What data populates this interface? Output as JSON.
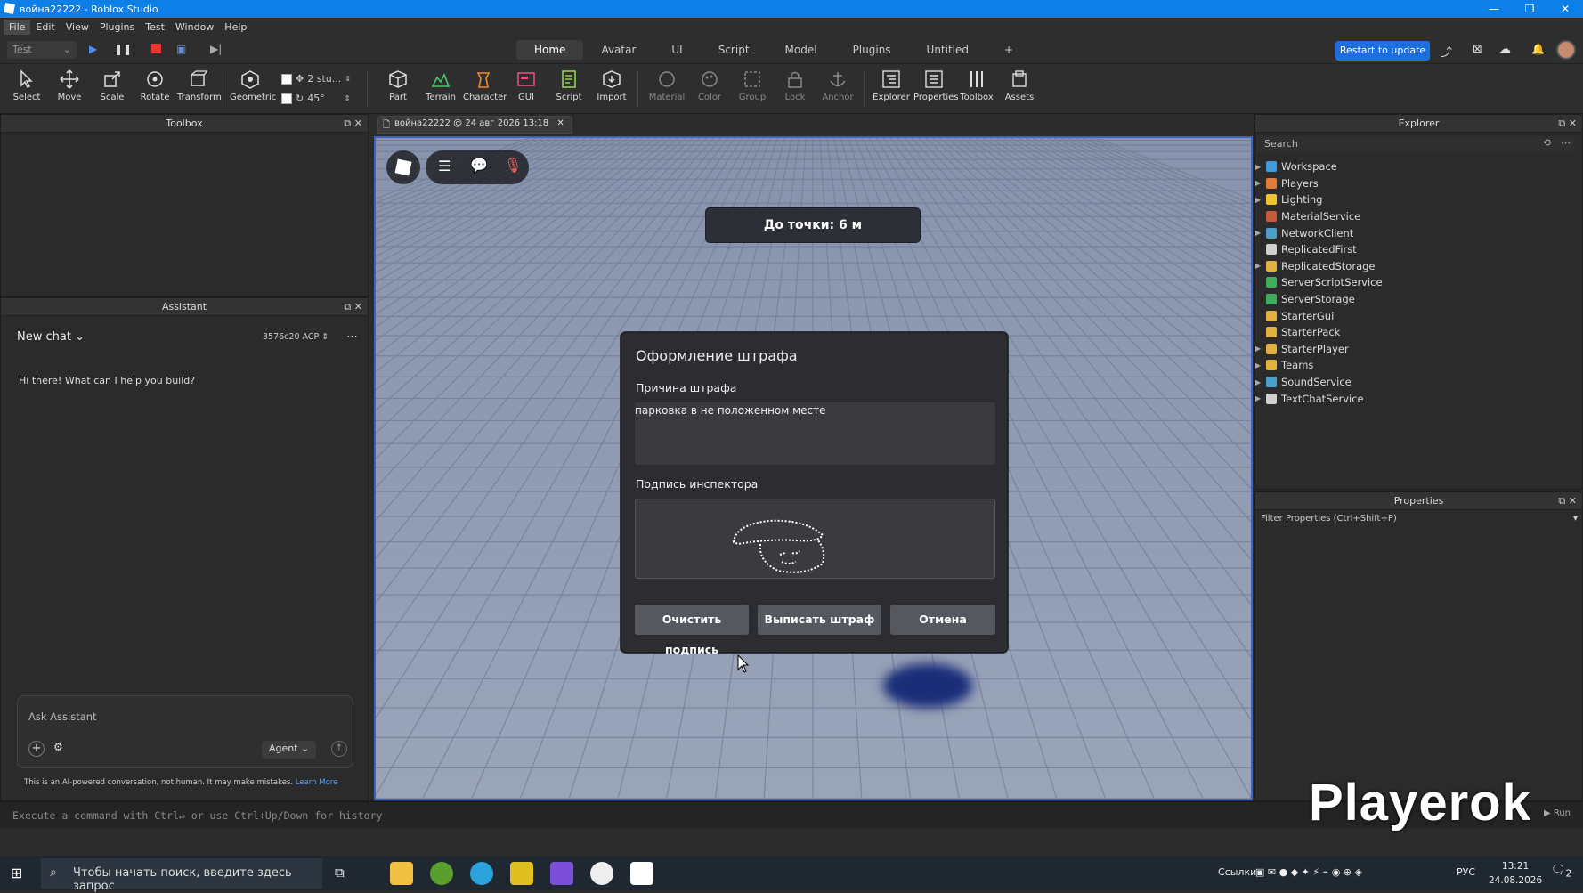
{
  "window": {
    "title": "война22222 - Roblox Studio",
    "min": "—",
    "max": "❐",
    "close": "✕"
  },
  "menu": [
    "File",
    "Edit",
    "View",
    "Plugins",
    "Test",
    "Window",
    "Help"
  ],
  "test_select": "Test",
  "ribbon_tabs": [
    "Home",
    "Avatar",
    "UI",
    "Script",
    "Model",
    "Plugins",
    "Untitled",
    "+"
  ],
  "restart_button": "Restart to update",
  "tools": {
    "select": "Select",
    "move": "Move",
    "scale": "Scale",
    "rotate": "Rotate",
    "transform": "Transform",
    "geometric": "Geometric",
    "stud_value": "2 stu...",
    "angle_value": "45°",
    "part": "Part",
    "terrain": "Terrain",
    "character": "Character",
    "gui": "GUI",
    "script": "Script",
    "import": "Import",
    "material": "Material",
    "color": "Color",
    "group": "Group",
    "lock": "Lock",
    "anchor": "Anchor",
    "explorer": "Explorer",
    "properties": "Properties",
    "toolbox": "Toolbox",
    "assets": "Assets"
  },
  "toolbox": {
    "title": "Toolbox"
  },
  "assistant": {
    "title": "Assistant",
    "chat_name": "New chat",
    "model": "3576c20 ACP",
    "greeting": "Hi there! What can I help you build?",
    "input_placeholder": "Ask Assistant",
    "agent": "Agent",
    "disclaimer": "This is an AI-powered conversation, not human. It may make mistakes.",
    "learn_more": "Learn More"
  },
  "doc_tab": {
    "label": "война22222 @ 24 авг 2026 13:18",
    "close": "✕"
  },
  "game": {
    "distance": "До точки: 6 м",
    "modal": {
      "title": "Оформление штрафа",
      "reason_label": "Причина штрафа",
      "reason_value": "парковка в не положенном месте",
      "signature_label": "Подпись инспектора",
      "clear_btn": "Очистить подпись",
      "issue_btn": "Выписать штраф",
      "cancel_btn": "Отмена"
    }
  },
  "explorer": {
    "title": "Explorer",
    "search_placeholder": "Search",
    "items": [
      {
        "label": "Workspace",
        "expand": true,
        "icon": "workspace-icon",
        "color": "#3e9bdc"
      },
      {
        "label": "Players",
        "expand": true,
        "icon": "players-icon",
        "color": "#e07b39"
      },
      {
        "label": "Lighting",
        "expand": true,
        "icon": "lighting-icon",
        "color": "#f0c330"
      },
      {
        "label": "MaterialService",
        "expand": false,
        "icon": "material-service-icon",
        "color": "#c75a3a"
      },
      {
        "label": "NetworkClient",
        "expand": true,
        "icon": "network-client-icon",
        "color": "#4aa0c8"
      },
      {
        "label": "ReplicatedFirst",
        "expand": false,
        "icon": "replicated-first-icon",
        "color": "#cfcfcf"
      },
      {
        "label": "ReplicatedStorage",
        "expand": true,
        "icon": "replicated-storage-icon",
        "color": "#e0b040"
      },
      {
        "label": "ServerScriptService",
        "expand": false,
        "icon": "server-script-service-icon",
        "color": "#3fae5a"
      },
      {
        "label": "ServerStorage",
        "expand": false,
        "icon": "server-storage-icon",
        "color": "#3fae5a"
      },
      {
        "label": "StarterGui",
        "expand": false,
        "icon": "starter-gui-icon",
        "color": "#e0b040"
      },
      {
        "label": "StarterPack",
        "expand": false,
        "icon": "starter-pack-icon",
        "color": "#e0b040"
      },
      {
        "label": "StarterPlayer",
        "expand": true,
        "icon": "starter-player-icon",
        "color": "#e0b040"
      },
      {
        "label": "Teams",
        "expand": true,
        "icon": "teams-icon",
        "color": "#e0b040"
      },
      {
        "label": "SoundService",
        "expand": true,
        "icon": "sound-service-icon",
        "color": "#4aa0c8"
      },
      {
        "label": "TextChatService",
        "expand": true,
        "icon": "text-chat-service-icon",
        "color": "#cfcfcf"
      }
    ]
  },
  "properties": {
    "title": "Properties",
    "filter_placeholder": "Filter Properties (Ctrl+Shift+P)"
  },
  "command_bar": {
    "placeholder": "Execute a command with Ctrl↵ or use Ctrl+Up/Down for history",
    "run": "▶ Run"
  },
  "watermark": "Playerok",
  "taskbar": {
    "search": "Чтобы начать поиск, введите здесь запрос",
    "links": "Ссылки",
    "lang": "РУС",
    "time": "13:21",
    "date": "24.08.2026",
    "notif": "2"
  }
}
